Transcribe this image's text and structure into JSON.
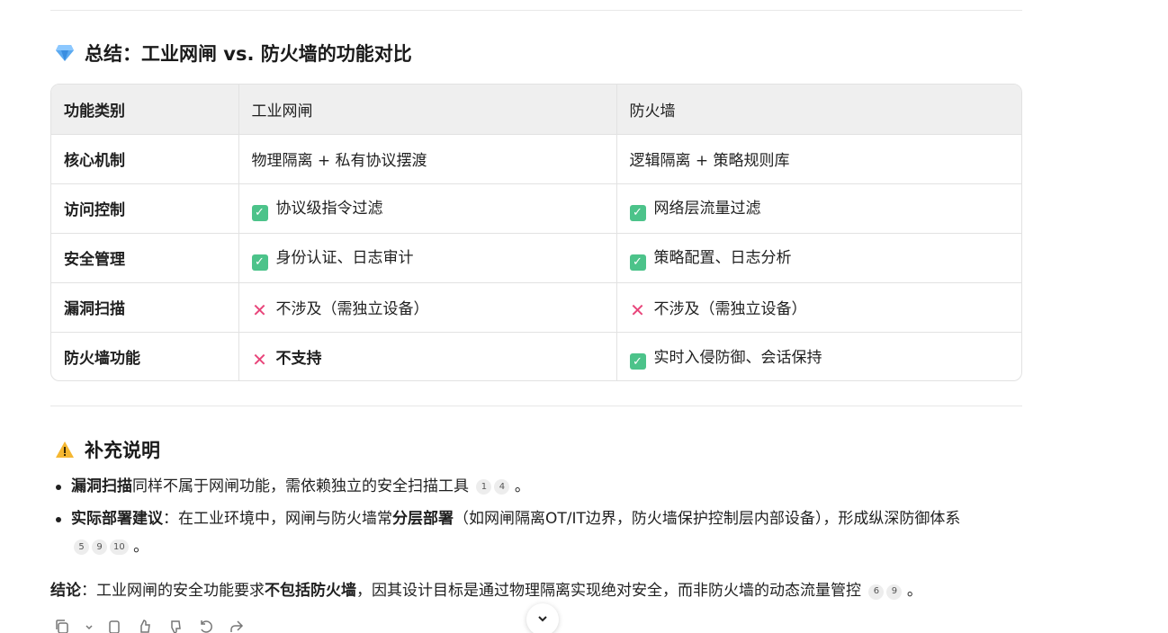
{
  "summary": {
    "title": "总结：工业网闸 vs. 防火墙的功能对比",
    "icon": "gem-icon",
    "table": {
      "headers": [
        "功能类别",
        "工业网闸",
        "防火墙"
      ],
      "rows": [
        {
          "category": "核心机制",
          "gateway": "物理隔离 + 私有协议摆渡",
          "firewall": "逻辑隔离 + 策略规则库",
          "gateway_mark": "",
          "firewall_mark": ""
        },
        {
          "category": "访问控制",
          "gateway": "协议级指令过滤",
          "firewall": "网络层流量过滤",
          "gateway_mark": "check",
          "firewall_mark": "check"
        },
        {
          "category": "安全管理",
          "gateway": "身份认证、日志审计",
          "firewall": "策略配置、日志分析",
          "gateway_mark": "check",
          "firewall_mark": "check"
        },
        {
          "category": "漏洞扫描",
          "gateway": "不涉及（需独立设备）",
          "firewall": "不涉及（需独立设备）",
          "gateway_mark": "cross",
          "firewall_mark": "cross"
        },
        {
          "category": "防火墙功能",
          "gateway": "不支持",
          "firewall": "实时入侵防御、会话保持",
          "gateway_mark": "cross",
          "firewall_mark": "check"
        }
      ]
    }
  },
  "notes": {
    "title": "补充说明",
    "icon": "warning-icon",
    "items": [
      {
        "bold": "漏洞扫描",
        "text": "同样不属于网闸功能，需依赖独立的安全扫描工具",
        "cites": [
          "1",
          "4"
        ],
        "end": "。"
      },
      {
        "bold": "实际部署建议",
        "text1": "：在工业环境中，网闸与防火墙常",
        "bold2": "分层部署",
        "text2": "（如网闸隔离OT/IT边界，防火墙保护控制层内部设备），形成纵深防御体系",
        "cites": [
          "5",
          "9",
          "10"
        ],
        "end": "。"
      }
    ]
  },
  "conclusion": {
    "label": "结论",
    "text1": "：工业网闸的安全功能要求",
    "bold": "不包括防火墙",
    "text2": "，因其设计目标是通过物理隔离实现绝对安全，而非防火墙的动态流量管控",
    "cites": [
      "6",
      "9"
    ],
    "end": "。"
  }
}
